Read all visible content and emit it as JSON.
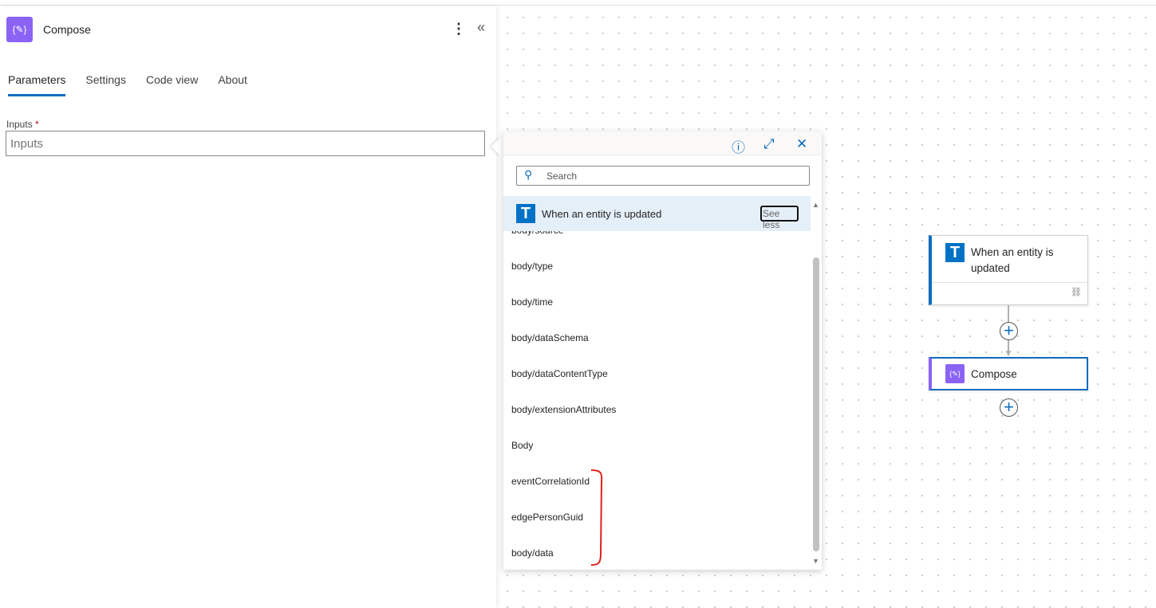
{
  "panel": {
    "title": "Compose",
    "icon": "compose-braces-icon",
    "tabs": [
      "Parameters",
      "Settings",
      "Code view",
      "About"
    ],
    "active_tab": "Parameters",
    "inputs_label": "Inputs",
    "required_mark": "*",
    "inputs_placeholder": "Inputs"
  },
  "popup": {
    "search_placeholder": "Search",
    "group_title": "When an entity is updated",
    "see_less": "See less",
    "items": [
      "body/source",
      "body/type",
      "body/time",
      "body/dataSchema",
      "body/dataContentType",
      "body/extensionAttributes",
      "Body",
      "eventCorrelationId",
      "edgePersonGuid",
      "body/data"
    ]
  },
  "canvas": {
    "trigger_title": "When an entity is updated",
    "trigger_icon_letter": "T",
    "action_title": "Compose"
  },
  "colors": {
    "accent": "#0f6cbd",
    "compose": "#8a63f5",
    "trigger": "#0072c6",
    "annotation": "#e0201c"
  }
}
